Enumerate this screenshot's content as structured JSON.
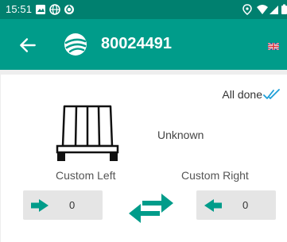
{
  "status_bar": {
    "time": "15:51"
  },
  "app_bar": {
    "title": "80024491"
  },
  "main": {
    "status": "All done",
    "condition": "Unknown",
    "left": {
      "label": "Custom Left",
      "value": "0"
    },
    "right": {
      "label": "Custom Right",
      "value": "0"
    }
  },
  "colors": {
    "status_bar": "#00806f",
    "app_bar": "#009c8a",
    "accent": "#009c8a",
    "check": "#1e9fd8"
  },
  "icons": {
    "back": "arrow-left-icon",
    "logo": "app-logo-icon",
    "language": "uk-flag-icon",
    "done": "double-check-icon",
    "pallet": "pallet-icon",
    "swap": "swap-arrows-icon"
  }
}
